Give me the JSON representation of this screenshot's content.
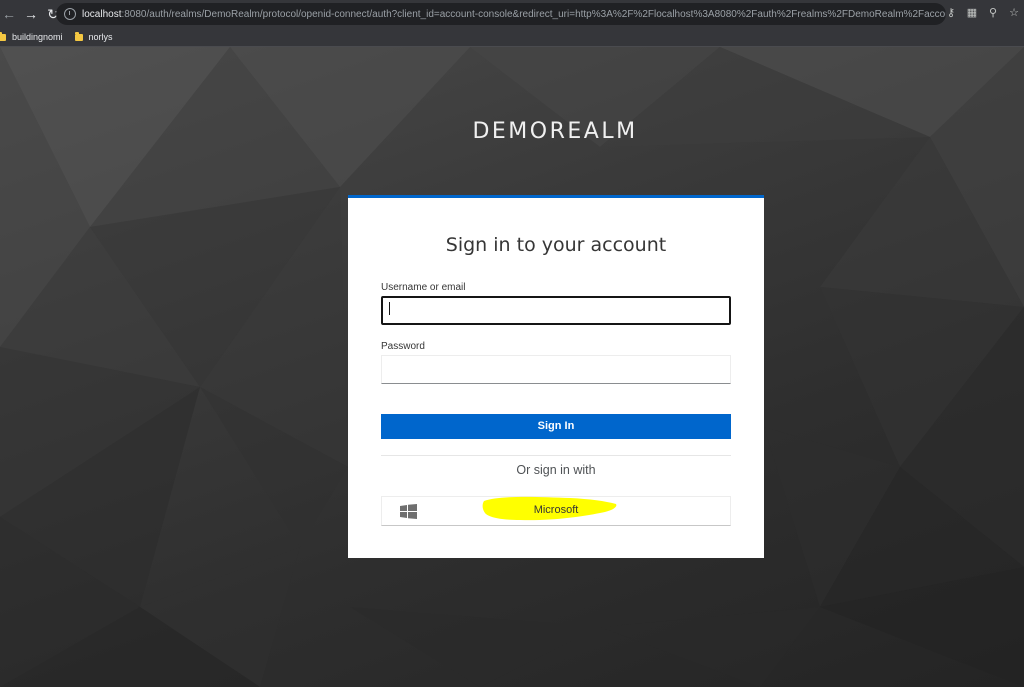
{
  "browser": {
    "url_host": "localhost",
    "url_path": ":8080/auth/realms/DemoRealm/protocol/openid-connect/auth?client_id=account-console&redirect_uri=http%3A%2F%2Flocalhost%3A8080%2Fauth%2Frealms%2FDemoRealm%2Faccount%2F%23%2..."
  },
  "bookmarks": [
    {
      "label": "buildingnomi"
    },
    {
      "label": "norlys"
    }
  ],
  "page": {
    "realm_title": "DEMOREALM"
  },
  "login": {
    "heading": "Sign in to your account",
    "username_label": "Username or email",
    "username_value": "",
    "password_label": "Password",
    "password_value": "",
    "submit_label": "Sign In",
    "divider_text": "Or sign in with",
    "providers": [
      {
        "label": "Microsoft",
        "icon": "windows-icon"
      }
    ]
  },
  "colors": {
    "primary": "#0066cc",
    "highlight": "#ffff00",
    "page_background": "#2e2e2e"
  }
}
